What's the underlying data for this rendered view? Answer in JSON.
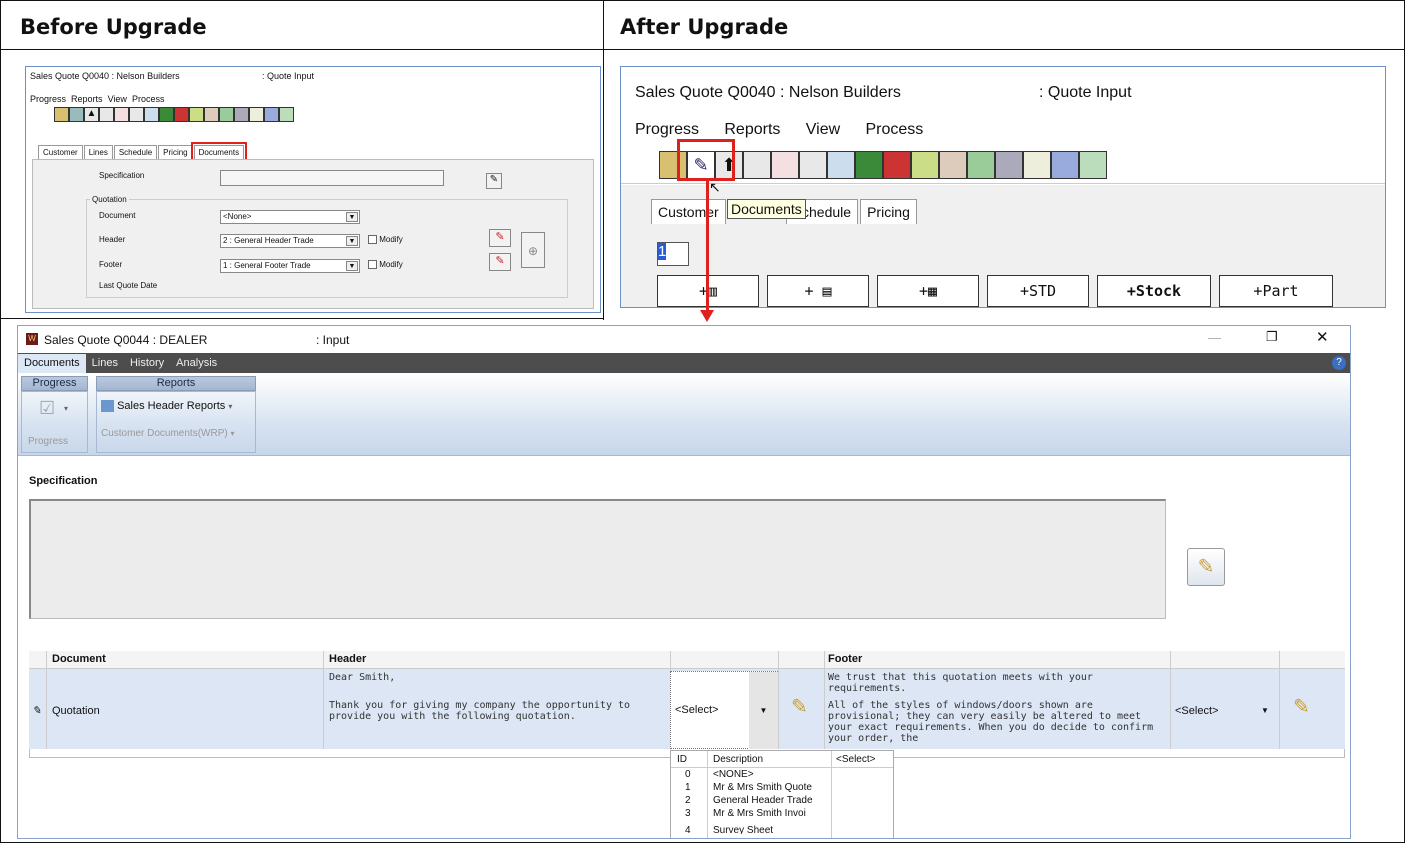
{
  "panels": {
    "before_title": "Before Upgrade",
    "after_title": "After Upgrade"
  },
  "old_app": {
    "title": "Sales Quote Q0040  : Nelson Builders",
    "mode": ": Quote Input",
    "menu": [
      "Progress",
      "Reports",
      "View",
      "Process"
    ],
    "tabs": [
      "Customer",
      "Lines",
      "Schedule",
      "Pricing",
      "Documents"
    ],
    "specification_label": "Specification",
    "quotation_group_label": "Quotation",
    "document_label": "Document",
    "document_value": "<None>",
    "header_label": "Header",
    "header_value": "2  : General Header Trade",
    "footer_label": "Footer",
    "footer_value": "1  : General Footer Trade",
    "modify_label": "Modify",
    "last_quote_label": "Last Quote Date"
  },
  "old_app_zoom": {
    "title": "Sales Quote Q0040  : Nelson Builders",
    "mode": ": Quote Input",
    "menu": [
      "Progress",
      "Reports",
      "View",
      "Process"
    ],
    "tabs": [
      "Customer",
      "Schedule",
      "Pricing"
    ],
    "tooltip": "Documents",
    "line_value": "1",
    "buttons": [
      "+",
      "+",
      "+",
      "+STD",
      "+Stock",
      "+Part",
      "+"
    ]
  },
  "new_app": {
    "title": "Sales Quote Q0044  : DEALER",
    "mode": ": Input",
    "tabs": [
      "Documents",
      "Lines",
      "History",
      "Analysis"
    ],
    "groups": {
      "progress_title": "Progress",
      "progress_label": "Progress",
      "reports_title": "Reports",
      "sales_header_reports": "Sales Header Reports",
      "customer_documents": "Customer Documents(WRP)"
    },
    "specification_label": "Specification",
    "grid": {
      "col_document": "Document",
      "col_header": "Header",
      "col_footer": "Footer",
      "row_document": "Quotation",
      "header_line1": "Dear Smith,",
      "header_line2": "Thank you for giving my company the opportunity to provide you with the following quotation.",
      "footer_line1": "We trust that this quotation meets with your requirements.",
      "footer_line2": "All of the styles of windows/doors shown are provisional; they can very easily be altered to meet your exact requirements. When you do decide to confirm your order, the",
      "header_select": "<Select>",
      "footer_select": "<Select>"
    },
    "dropdown": {
      "col_id": "ID",
      "col_desc": "Description",
      "col_select": "<Select>",
      "rows": [
        {
          "id": "0",
          "desc": "<NONE>"
        },
        {
          "id": "1",
          "desc": "Mr & Mrs Smith Quote"
        },
        {
          "id": "2",
          "desc": "General Header Trade"
        },
        {
          "id": "3",
          "desc": "Mr & Mrs Smith Invoi"
        },
        {
          "id": "4",
          "desc": "Survey Sheet"
        }
      ]
    }
  },
  "colors": {
    "highlight_red": "#e0201c",
    "ribbon_dark": "#4d4d4d",
    "row_blue": "#dce6f5"
  }
}
